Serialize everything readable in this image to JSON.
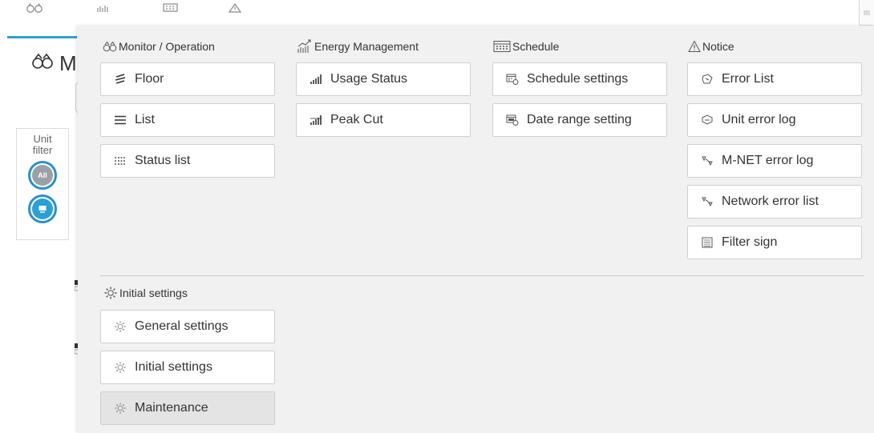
{
  "background": {
    "nav_icons": [
      "binoculars-icon",
      "energy-bars-icon",
      "calendar-icon",
      "warning-icon"
    ],
    "page_title": "M",
    "page_title_icon": "binoculars-icon",
    "unit_filter": {
      "label": "Unit filter",
      "all_label": "All",
      "device_icon": "indoor-unit-icon"
    }
  },
  "menu": {
    "sections": {
      "monitor": {
        "title": "Monitor / Operation",
        "icon": "binoculars-icon",
        "items": [
          {
            "label": "Floor",
            "icon": "floor-layers-icon"
          },
          {
            "label": "List",
            "icon": "list-lines-icon"
          },
          {
            "label": "Status list",
            "icon": "status-grid-icon"
          }
        ]
      },
      "energy": {
        "title": "Energy Management",
        "icon": "energy-chart-icon",
        "items": [
          {
            "label": "Usage Status",
            "icon": "bar-signal-icon"
          },
          {
            "label": "Peak Cut",
            "icon": "bar-signal-icon"
          }
        ]
      },
      "schedule": {
        "title": "Schedule",
        "icon": "calendar-icon",
        "items": [
          {
            "label": "Schedule settings",
            "icon": "calendar-gear-icon"
          },
          {
            "label": "Date range setting",
            "icon": "calendar-range-icon"
          }
        ]
      },
      "notice": {
        "title": "Notice",
        "icon": "warning-icon",
        "items": [
          {
            "label": "Error List",
            "icon": "error-tag-icon"
          },
          {
            "label": "Unit error log",
            "icon": "unit-error-icon"
          },
          {
            "label": "M-NET error log",
            "icon": "network-error-icon"
          },
          {
            "label": "Network error list",
            "icon": "network-error-icon"
          },
          {
            "label": "Filter sign",
            "icon": "filter-sign-icon"
          }
        ]
      },
      "initial": {
        "title": "Initial settings",
        "icon": "gear-icon",
        "items": [
          {
            "label": "General settings",
            "icon": "gear-icon"
          },
          {
            "label": "Initial settings",
            "icon": "gear-icon"
          },
          {
            "label": "Maintenance",
            "icon": "gear-icon",
            "selected": true
          }
        ]
      }
    }
  },
  "colors": {
    "accent": "#2fa0d8",
    "menu_bg": "#f1f1f1",
    "button_bg": "#ffffff",
    "selected_bg": "#e4e4e4"
  }
}
